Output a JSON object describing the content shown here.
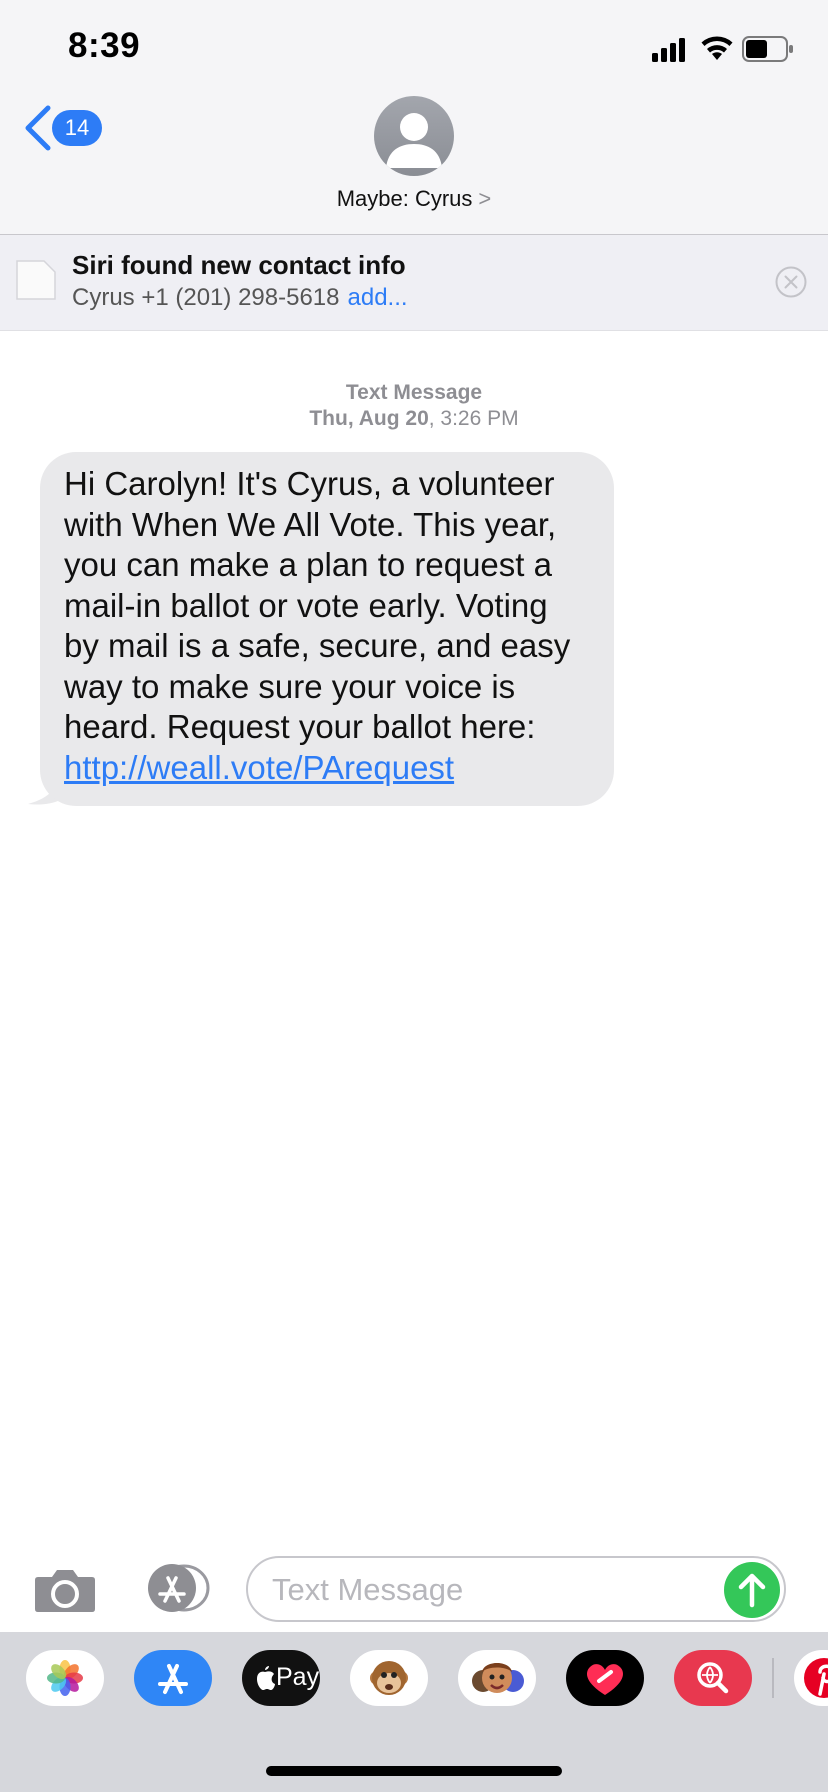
{
  "status": {
    "time": "8:39"
  },
  "nav": {
    "back_count": "14",
    "contact_name": "Maybe: Cyrus",
    "contact_chevron": ">"
  },
  "siri": {
    "title": "Siri found new contact info",
    "detail": "Cyrus +1 (201) 298-5618",
    "add": "add..."
  },
  "thread": {
    "service": "Text Message",
    "date": "Thu, Aug 20",
    "time": "3:26 PM"
  },
  "message": {
    "lines": [
      "Hi Carolyn! It's Cyrus, a volunteer",
      "with When We All Vote. This year,",
      "you can make a plan to request a",
      "mail-in ballot or vote early. Voting",
      "by mail is a safe, secure, and easy",
      "way to make sure your voice is",
      "heard. Request your ballot here:"
    ],
    "link": "http://weall.vote/PArequest"
  },
  "compose": {
    "placeholder": "Text Message"
  },
  "drawer": {
    "apple_pay_label": "Pay",
    "apps": [
      "photos-icon",
      "app-store-icon",
      "apple-pay-icon",
      "animoji-monkey-icon",
      "memoji-icon",
      "digital-touch-icon",
      "image-search-icon",
      "pinterest-icon"
    ]
  },
  "colors": {
    "accent": "#2d7cf6",
    "send": "#34c759",
    "bubble": "#e9e9eb"
  }
}
